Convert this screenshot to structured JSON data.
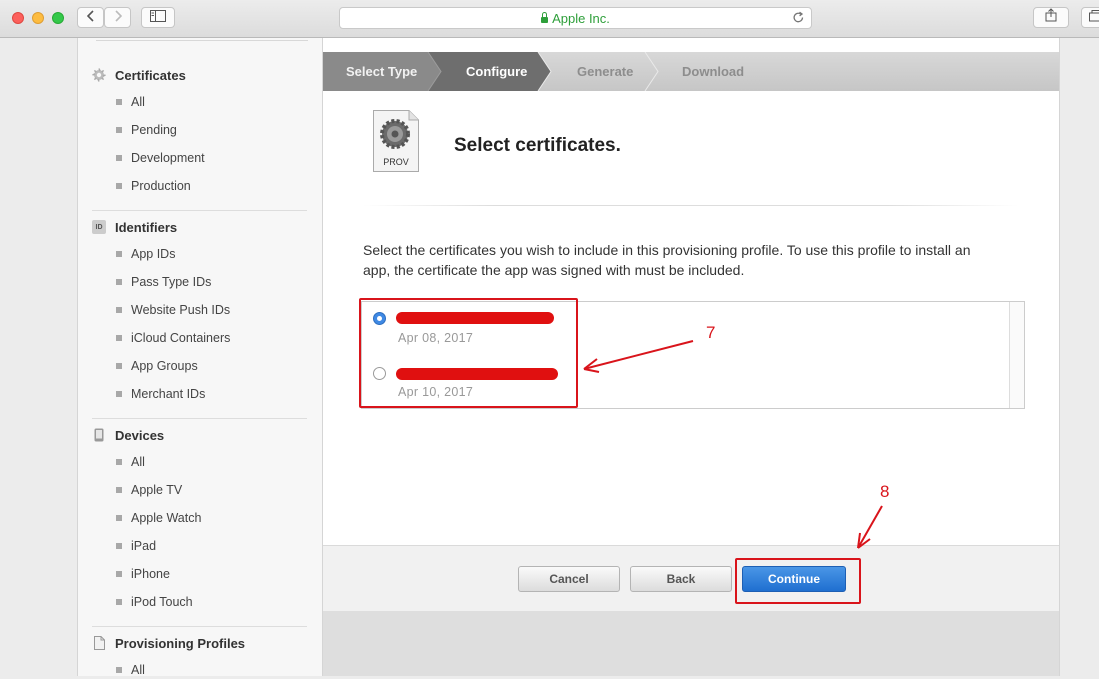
{
  "browser": {
    "address": "Apple Inc."
  },
  "sidebar": {
    "sections": [
      {
        "title": "Certificates",
        "icon": "certificate-icon",
        "items": [
          "All",
          "Pending",
          "Development",
          "Production"
        ]
      },
      {
        "title": "Identifiers",
        "icon": "id-icon",
        "icon_text": "ID",
        "items": [
          "App IDs",
          "Pass Type IDs",
          "Website Push IDs",
          "iCloud Containers",
          "App Groups",
          "Merchant IDs"
        ]
      },
      {
        "title": "Devices",
        "icon": "device-icon",
        "items": [
          "All",
          "Apple TV",
          "Apple Watch",
          "iPad",
          "iPhone",
          "iPod Touch"
        ]
      },
      {
        "title": "Provisioning Profiles",
        "icon": "document-icon",
        "items": [
          "All"
        ]
      }
    ]
  },
  "steps": [
    "Select Type",
    "Configure",
    "Generate",
    "Download"
  ],
  "icon_label": "PROV",
  "heading": "Select certificates.",
  "description": "Select the certificates you wish to include in this provisioning profile. To use this profile to install an app, the certificate the app was signed with must be included.",
  "certificates": [
    {
      "date": "Apr 08, 2017",
      "selected": true
    },
    {
      "date": "Apr 10, 2017",
      "selected": false
    }
  ],
  "annotations": [
    "7",
    "8"
  ],
  "buttons": {
    "cancel": "Cancel",
    "back": "Back",
    "continue": "Continue"
  },
  "colors": {
    "annotation": "#d9141b",
    "primary_button": "#2a78d8",
    "radio_selected": "#3f89e4"
  }
}
